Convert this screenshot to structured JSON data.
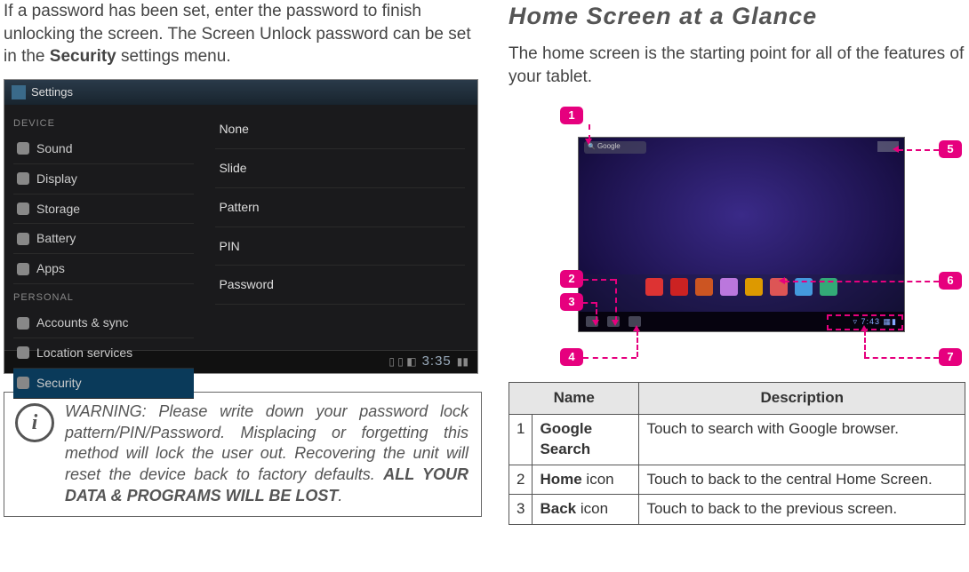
{
  "left": {
    "para_pre": "If a password has been set, enter the password to finish unlocking the screen. The Screen Unlock password can be set in the ",
    "para_bold": "Security",
    "para_post": " settings menu.",
    "settings": {
      "title": "Settings",
      "section_device": "DEVICE",
      "section_personal": "PERSONAL",
      "items_device": [
        "Sound",
        "Display",
        "Storage",
        "Battery",
        "Apps"
      ],
      "items_personal": [
        "Accounts & sync",
        "Location services",
        "Security"
      ],
      "options": [
        "None",
        "Slide",
        "Pattern",
        "PIN",
        "Password"
      ],
      "time": "3:35"
    },
    "warning": {
      "text_pre": "WARNING: Please write down your password lock pattern/PIN/Password. Misplacing or forgetting this method will lock the user out. Recovering the unit will reset the device back to factory defaults. ",
      "text_bold": "ALL YOUR DATA & PROGRAMS WILL BE LOST",
      "text_post": "."
    }
  },
  "right": {
    "title": "Home Screen at a Glance",
    "intro": "The home screen is the starting point for all of the features of your tablet.",
    "badges": [
      "1",
      "2",
      "3",
      "4",
      "5",
      "6",
      "7"
    ],
    "tablet": {
      "search_label": "Google",
      "nav_time": "7:43",
      "dock_colors": [
        "#d33",
        "#c22",
        "#c52",
        "#b7d",
        "#d90",
        "#d55",
        "#49d",
        "#3a7"
      ]
    },
    "table": {
      "head_name": "Name",
      "head_desc": "Description",
      "rows": [
        {
          "num": "1",
          "name_bold": "Google Search",
          "name_rest": "",
          "desc": "Touch to search with Google browser."
        },
        {
          "num": "2",
          "name_bold": "Home",
          "name_rest": " icon",
          "desc": "Touch to back to the central Home Screen."
        },
        {
          "num": "3",
          "name_bold": "Back",
          "name_rest": " icon",
          "desc": "Touch to back to the previous screen."
        }
      ]
    }
  }
}
